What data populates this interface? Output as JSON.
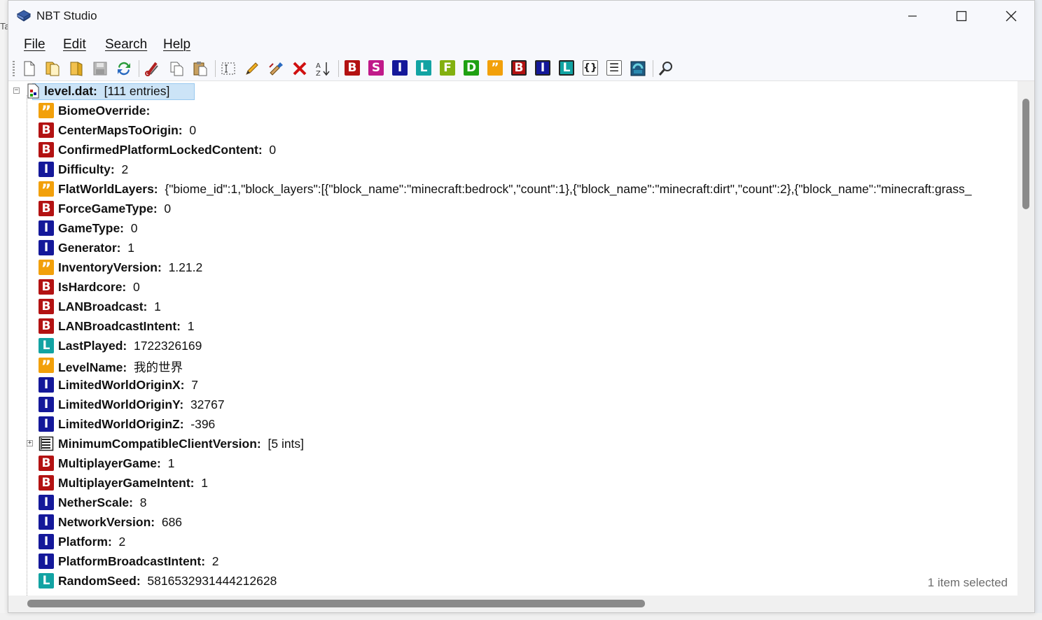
{
  "window": {
    "title": "NBT Studio",
    "app_icon": "book-stack-icon",
    "controls": [
      "minimize-icon",
      "maximize-icon",
      "close-icon"
    ]
  },
  "menu": [
    {
      "label": "File"
    },
    {
      "label": "Edit"
    },
    {
      "label": "Search"
    },
    {
      "label": "Help"
    }
  ],
  "toolbar": {
    "file_buttons": [
      "new-file-icon",
      "open-file-icon",
      "open-folder-icon",
      "save-icon",
      "refresh-icon"
    ],
    "edit_buttons": [
      "cut-icon",
      "copy-icon",
      "paste-icon",
      "rename-icon",
      "edit-icon",
      "edit-snbt-icon",
      "delete-icon",
      "sort-icon"
    ],
    "tag_buttons": [
      {
        "letter": "B",
        "type": "byte",
        "color": "#b31212"
      },
      {
        "letter": "S",
        "type": "short",
        "color": "#c01a8a"
      },
      {
        "letter": "I",
        "type": "int",
        "color": "#14189a"
      },
      {
        "letter": "L",
        "type": "long",
        "color": "#12a3a3"
      },
      {
        "letter": "F",
        "type": "float",
        "color": "#82b010"
      },
      {
        "letter": "D",
        "type": "double",
        "color": "#1ea012"
      },
      {
        "letter": "”",
        "type": "string",
        "color": "#f2a00a"
      },
      {
        "letter": "B",
        "type": "byte-array",
        "color": "#b31212"
      },
      {
        "letter": "I",
        "type": "int-array",
        "color": "#14189a"
      },
      {
        "letter": "L",
        "type": "long-array",
        "color": "#12a3a3"
      },
      {
        "letter": "{}",
        "type": "compound",
        "color": "#ffffff"
      },
      {
        "letter": "☰",
        "type": "list",
        "color": "#ffffff"
      }
    ],
    "extra_buttons": [
      "chunk-icon",
      "search-icon"
    ]
  },
  "tree": {
    "root": {
      "name": "level.dat:",
      "value": "[111 entries]"
    },
    "entries": [
      {
        "type": "string",
        "name": "BiomeOverride:",
        "value": ""
      },
      {
        "type": "byte",
        "name": "CenterMapsToOrigin:",
        "value": "0"
      },
      {
        "type": "byte",
        "name": "ConfirmedPlatformLockedContent:",
        "value": "0"
      },
      {
        "type": "int",
        "name": "Difficulty:",
        "value": "2"
      },
      {
        "type": "string",
        "name": "FlatWorldLayers:",
        "value": "{\"biome_id\":1,\"block_layers\":[{\"block_name\":\"minecraft:bedrock\",\"count\":1},{\"block_name\":\"minecraft:dirt\",\"count\":2},{\"block_name\":\"minecraft:grass_"
      },
      {
        "type": "byte",
        "name": "ForceGameType:",
        "value": "0"
      },
      {
        "type": "int",
        "name": "GameType:",
        "value": "0"
      },
      {
        "type": "int",
        "name": "Generator:",
        "value": "1"
      },
      {
        "type": "string",
        "name": "InventoryVersion:",
        "value": "1.21.2"
      },
      {
        "type": "byte",
        "name": "IsHardcore:",
        "value": "0"
      },
      {
        "type": "byte",
        "name": "LANBroadcast:",
        "value": "1"
      },
      {
        "type": "byte",
        "name": "LANBroadcastIntent:",
        "value": "1"
      },
      {
        "type": "long",
        "name": "LastPlayed:",
        "value": "1722326169"
      },
      {
        "type": "string",
        "name": "LevelName:",
        "value": "我的世界"
      },
      {
        "type": "int",
        "name": "LimitedWorldOriginX:",
        "value": "7"
      },
      {
        "type": "int",
        "name": "LimitedWorldOriginY:",
        "value": "32767"
      },
      {
        "type": "int",
        "name": "LimitedWorldOriginZ:",
        "value": "-396"
      },
      {
        "type": "list",
        "name": "MinimumCompatibleClientVersion:",
        "value": "[5 ints]",
        "expandable": true
      },
      {
        "type": "byte",
        "name": "MultiplayerGame:",
        "value": "1"
      },
      {
        "type": "byte",
        "name": "MultiplayerGameIntent:",
        "value": "1"
      },
      {
        "type": "int",
        "name": "NetherScale:",
        "value": "8"
      },
      {
        "type": "int",
        "name": "NetworkVersion:",
        "value": "686"
      },
      {
        "type": "int",
        "name": "Platform:",
        "value": "2"
      },
      {
        "type": "int",
        "name": "PlatformBroadcastIntent:",
        "value": "2"
      },
      {
        "type": "long",
        "name": "RandomSeed:",
        "value": "5816532931444212628"
      }
    ]
  },
  "status": {
    "text": "1 item selected"
  },
  "colors": {
    "byte": "#b31212",
    "int": "#14189a",
    "long": "#12a3a3",
    "string": "#f2a00a",
    "selection": "#cce4f7"
  }
}
